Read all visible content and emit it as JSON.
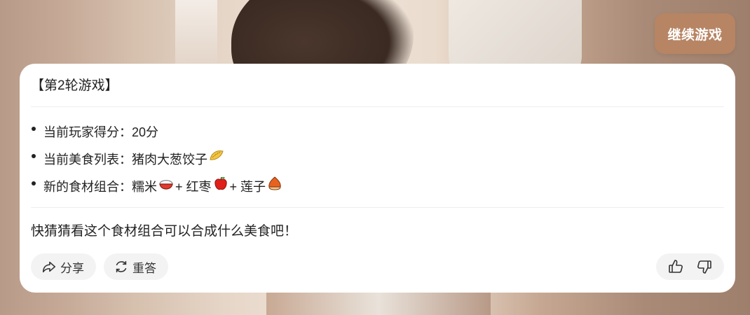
{
  "continue_button": {
    "label": "继续游戏"
  },
  "card": {
    "title": "【第2轮游戏】",
    "bullets": [
      {
        "label": "当前玩家得分：",
        "value": "20分"
      },
      {
        "label": "当前美食列表：",
        "value": "猪肉大葱饺子",
        "icon": "dumpling-emoji"
      },
      {
        "label": "新的食材组合：",
        "items": [
          {
            "text": "糯米",
            "icon": "rice-emoji"
          },
          {
            "text": " + 红枣",
            "icon": "red-apple-emoji"
          },
          {
            "text": " + 莲子",
            "icon": "chestnut-emoji"
          }
        ]
      }
    ],
    "message": "快猜猜看这个食材组合可以合成什么美食吧！",
    "actions": {
      "share": {
        "label": "分享",
        "icon": "share-icon"
      },
      "retry": {
        "label": "重答",
        "icon": "refresh-icon"
      },
      "like": {
        "icon": "thumbs-up-icon"
      },
      "dislike": {
        "icon": "thumbs-down-icon"
      }
    }
  }
}
